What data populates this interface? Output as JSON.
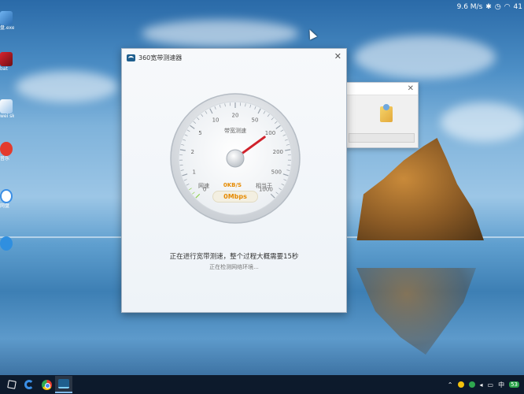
{
  "status_bar": {
    "network_speed": "9.6 M/s",
    "battery": "41"
  },
  "desktop_icons": [
    {
      "label": "盘.exe"
    },
    {
      "label": "bat"
    },
    {
      "label": "wei sk"
    },
    {
      "label": "音乐"
    },
    {
      "label": "网盘"
    },
    {
      "label": ""
    }
  ],
  "speed_window": {
    "title": "360宽带测速器",
    "gauge": {
      "caption": "带宽测速",
      "tick_labels": [
        "0",
        "1",
        "2",
        "5",
        "10",
        "20",
        "50",
        "100",
        "200",
        "500",
        "1000"
      ],
      "speed_label": "网速",
      "speed_kbs": "0KB/S",
      "equiv_label": "相当于",
      "speed_mbps": "0Mbps",
      "needle_value": 100
    },
    "status_main": "正在进行宽带测速，整个过程大概需要15秒",
    "status_sub": "正在检测网络环境..."
  },
  "taskbar": {
    "tray_ime": "中",
    "tray_badge": "53"
  }
}
